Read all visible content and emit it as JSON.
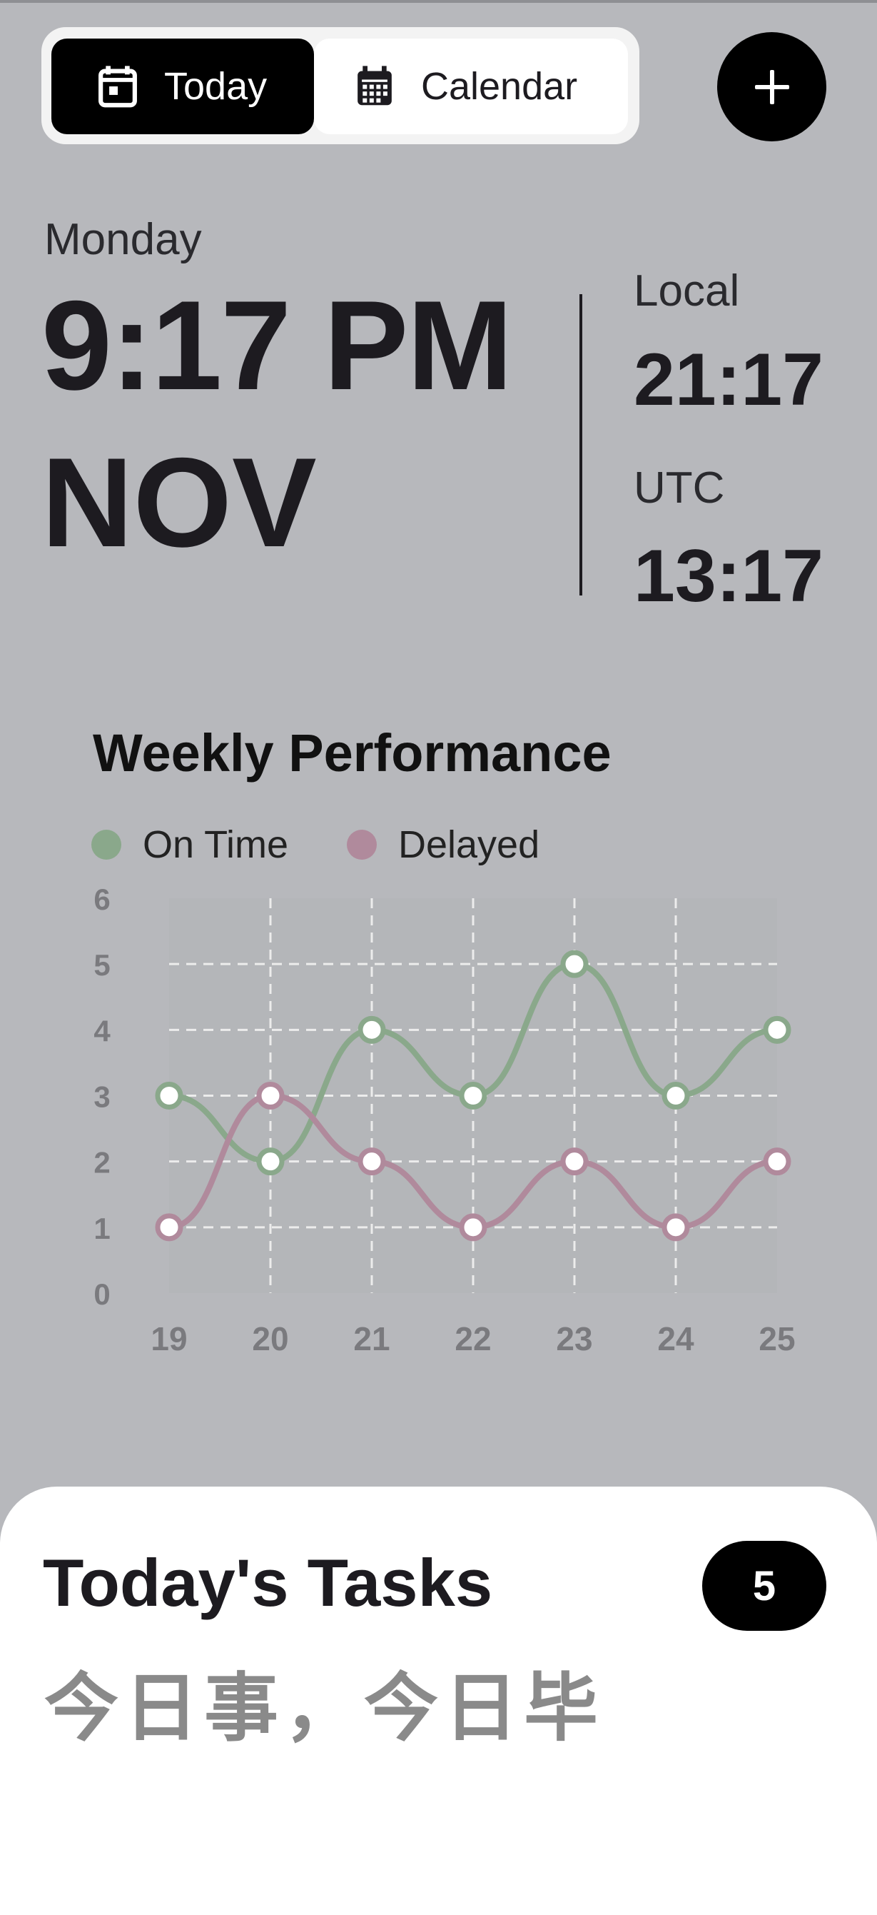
{
  "segmented": {
    "today_label": "Today",
    "calendar_label": "Calendar",
    "today_icon": "calendar-today-icon",
    "calendar_icon": "calendar-month-icon"
  },
  "add_button": {
    "icon": "plus-icon"
  },
  "clock": {
    "weekday": "Monday",
    "time": "9:17 PM",
    "month": "NOV",
    "local_label": "Local",
    "local_time": "21:17",
    "utc_label": "UTC",
    "utc_time": "13:17"
  },
  "chart_data": {
    "type": "line",
    "title": "Weekly Performance",
    "x": [
      "19",
      "20",
      "21",
      "22",
      "23",
      "24",
      "25"
    ],
    "series": [
      {
        "name": "On Time",
        "color": "#8aa88b",
        "values": [
          3,
          2,
          4,
          3,
          5,
          3,
          4
        ]
      },
      {
        "name": "Delayed",
        "color": "#b08a9c",
        "values": [
          1,
          3,
          2,
          1,
          2,
          1,
          2
        ]
      }
    ],
    "ylim": [
      0,
      6
    ],
    "yticks": [
      "0",
      "1",
      "2",
      "3",
      "4",
      "5",
      "6"
    ],
    "grid": true,
    "legend": "top-left"
  },
  "tasks": {
    "title": "Today's Tasks",
    "count": "5",
    "motto": "今日事，今日毕"
  }
}
